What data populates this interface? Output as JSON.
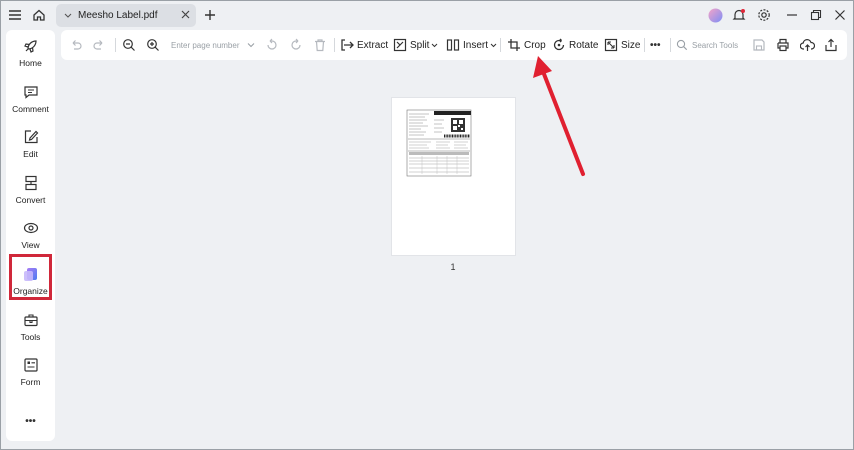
{
  "window": {
    "tab_title": "Meesho Label.pdf"
  },
  "sidebar": {
    "items": [
      {
        "label": "Home",
        "icon": "rocket-icon"
      },
      {
        "label": "Comment",
        "icon": "comment-icon"
      },
      {
        "label": "Edit",
        "icon": "edit-icon"
      },
      {
        "label": "Convert",
        "icon": "convert-icon"
      },
      {
        "label": "View",
        "icon": "view-icon"
      },
      {
        "label": "Organize",
        "icon": "organize-icon"
      },
      {
        "label": "Tools",
        "icon": "toolbox-icon"
      },
      {
        "label": "Form",
        "icon": "form-icon"
      }
    ],
    "more_label": "•••"
  },
  "toolbar": {
    "page_placeholder": "Enter page number",
    "extract_label": "Extract",
    "split_label": "Split",
    "insert_label": "Insert",
    "crop_label": "Crop",
    "rotate_label": "Rotate",
    "size_label": "Size",
    "more_label": "•••",
    "search_placeholder": "Search Tools"
  },
  "canvas": {
    "page_number": "1"
  },
  "colors": {
    "highlight": "#d0283a",
    "arrow": "#e02030"
  }
}
